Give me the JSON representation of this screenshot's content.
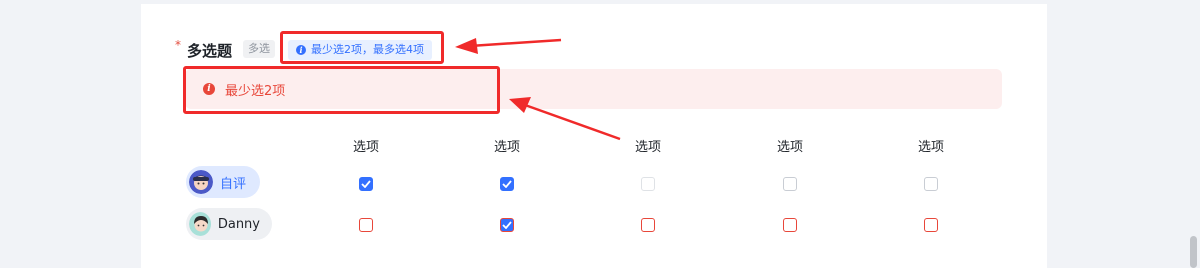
{
  "question": {
    "required_mark": "*",
    "title": "多选题",
    "type_badge": "多选",
    "hint": "最少选2项，最多选4项",
    "error": "最少选2项"
  },
  "columns": [
    "选项",
    "选项",
    "选项",
    "选项",
    "选项"
  ],
  "rows": [
    {
      "name": "自评",
      "states": [
        "checked",
        "checked",
        "disabled",
        "empty",
        "empty"
      ]
    },
    {
      "name": "Danny",
      "states": [
        "error",
        "checked-error",
        "error",
        "error",
        "error"
      ]
    }
  ],
  "colors": {
    "accent": "#3370ff",
    "error": "#e8473a",
    "annotation": "#f02a2a"
  },
  "icons": {
    "hint": "info-icon",
    "error": "error-info-icon",
    "check": "checkmark-icon"
  }
}
